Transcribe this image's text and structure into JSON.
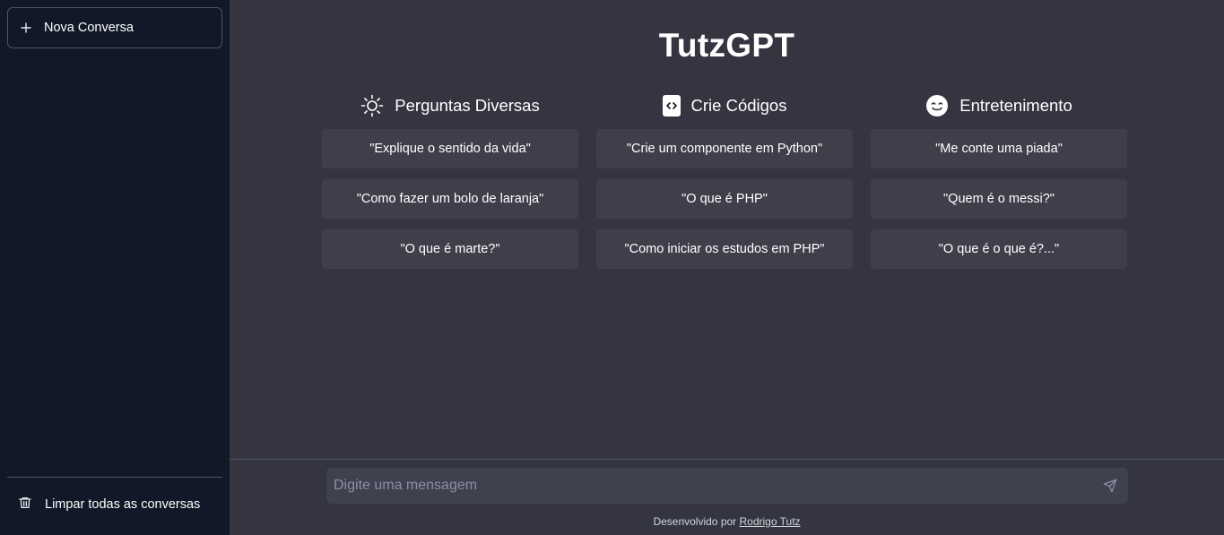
{
  "sidebar": {
    "new_chat_label": "Nova Conversa",
    "clear_all_label": "Limpar todas as conversas"
  },
  "main": {
    "title": "TutzGPT",
    "columns": [
      {
        "icon": "sun-icon",
        "heading": "Perguntas Diversas",
        "examples": [
          "\"Explique o sentido da vida\"",
          "\"Como fazer um bolo de laranja\"",
          "\"O que é marte?\""
        ]
      },
      {
        "icon": "code-icon",
        "heading": "Crie Códigos",
        "examples": [
          "\"Crie um componente em Python\"",
          "\"O que é PHP\"",
          "\"Como iniciar os estudos em PHP\""
        ]
      },
      {
        "icon": "smile-icon",
        "heading": "Entretenimento",
        "examples": [
          "\"Me conte uma piada\"",
          "\"Quem é o messi?\"",
          "\"O que é o que é?...\""
        ]
      }
    ]
  },
  "composer": {
    "placeholder": "Digite uma mensagem",
    "value": ""
  },
  "footer": {
    "prefix": "Desenvolvido por ",
    "author": "Rodrigo Tutz"
  },
  "colors": {
    "sidebar_bg": "#111827",
    "main_bg": "#343541",
    "chip_bg": "#3e3f4b",
    "input_bg": "#40414f",
    "border": "#4b5563"
  }
}
